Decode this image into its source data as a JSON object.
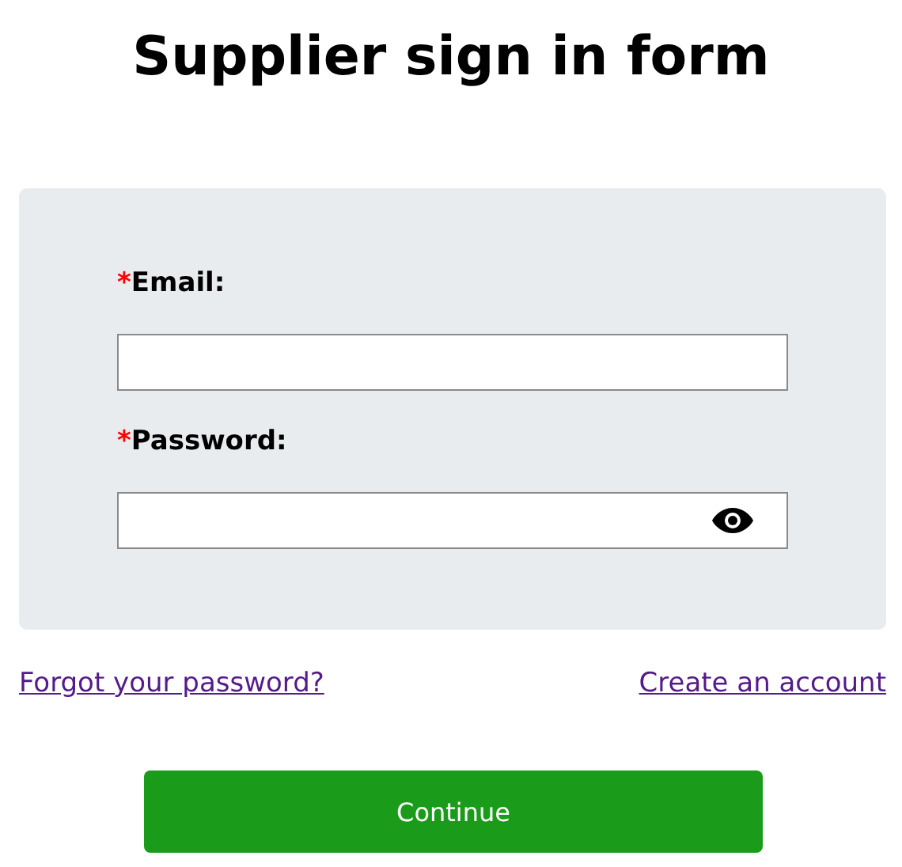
{
  "title": "Supplier sign in form",
  "fields": [
    {
      "kind": "text",
      "required_mark": "*",
      "label": "Email:"
    },
    {
      "kind": "password",
      "required_mark": "*",
      "label": "Password:"
    }
  ],
  "links": [
    {
      "label": "Forgot your password?"
    },
    {
      "label": "Create an account"
    }
  ],
  "button": {
    "label": "Continue"
  }
}
